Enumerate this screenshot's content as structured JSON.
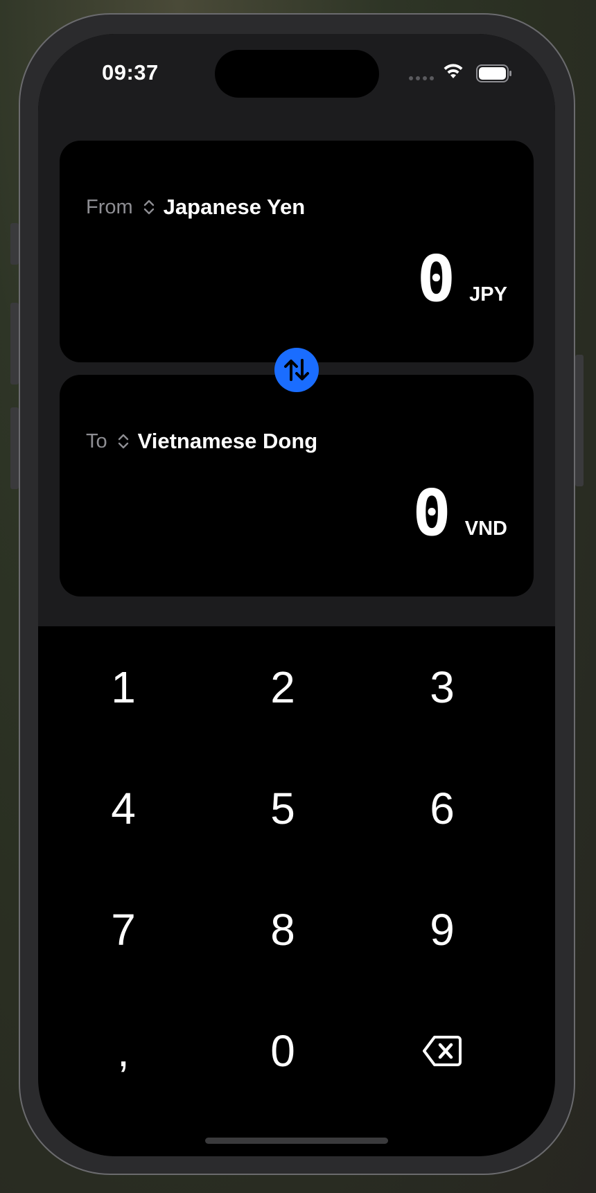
{
  "status_bar": {
    "time": "09:37"
  },
  "from_card": {
    "label": "From",
    "currency_name": "Japanese Yen",
    "amount": "0",
    "code": "JPY"
  },
  "to_card": {
    "label": "To",
    "currency_name": "Vietnamese Dong",
    "amount": "0",
    "code": "VND"
  },
  "keypad": {
    "keys": [
      "1",
      "2",
      "3",
      "4",
      "5",
      "6",
      "7",
      "8",
      "9",
      ",",
      "0"
    ],
    "backspace_icon": "delete-left-icon"
  },
  "colors": {
    "accent": "#1a6dff",
    "card_background": "#000000",
    "panel_background": "#1c1c1e",
    "secondary_text": "#8e8e93"
  }
}
